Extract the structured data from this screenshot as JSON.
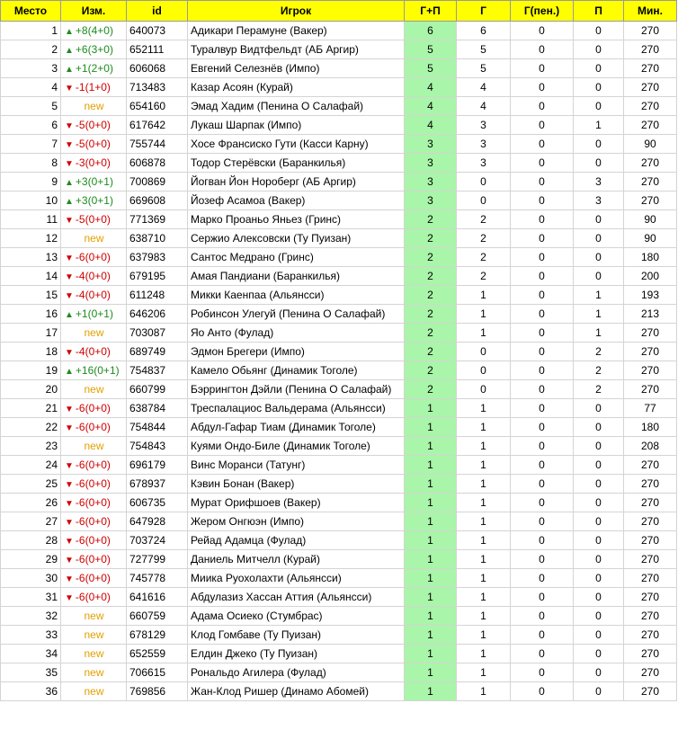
{
  "headers": [
    "Место",
    "Изм.",
    "id",
    "Игрок",
    "Г+П",
    "Г",
    "Г(пен.)",
    "П",
    "Мин."
  ],
  "rows": [
    {
      "place": "1",
      "dir": "up",
      "change": "+8(4+0)",
      "id": "640073",
      "player": "Адикари Перамуне (Вакер)",
      "gp": "6",
      "g": "6",
      "gpen": "0",
      "p": "0",
      "min": "270"
    },
    {
      "place": "2",
      "dir": "up",
      "change": "+6(3+0)",
      "id": "652111",
      "player": "Туралвур Видтфельдт (АБ Аргир)",
      "gp": "5",
      "g": "5",
      "gpen": "0",
      "p": "0",
      "min": "270"
    },
    {
      "place": "3",
      "dir": "up",
      "change": "+1(2+0)",
      "id": "606068",
      "player": "Евгений Селезнёв (Импо)",
      "gp": "5",
      "g": "5",
      "gpen": "0",
      "p": "0",
      "min": "270"
    },
    {
      "place": "4",
      "dir": "down",
      "change": "-1(1+0)",
      "id": "713483",
      "player": "Казар Асоян (Курай)",
      "gp": "4",
      "g": "4",
      "gpen": "0",
      "p": "0",
      "min": "270"
    },
    {
      "place": "5",
      "dir": "new",
      "change": "new",
      "id": "654160",
      "player": "Эмад Хадим (Пенина О Салафай)",
      "gp": "4",
      "g": "4",
      "gpen": "0",
      "p": "0",
      "min": "270"
    },
    {
      "place": "6",
      "dir": "down",
      "change": "-5(0+0)",
      "id": "617642",
      "player": "Лукаш Шарпак (Импо)",
      "gp": "4",
      "g": "3",
      "gpen": "0",
      "p": "1",
      "min": "270"
    },
    {
      "place": "7",
      "dir": "down",
      "change": "-5(0+0)",
      "id": "755744",
      "player": "Хосе Франсиско Гути (Касси Карну)",
      "gp": "3",
      "g": "3",
      "gpen": "0",
      "p": "0",
      "min": "90"
    },
    {
      "place": "8",
      "dir": "down",
      "change": "-3(0+0)",
      "id": "606878",
      "player": "Тодор Стерёвски (Баранкилья)",
      "gp": "3",
      "g": "3",
      "gpen": "0",
      "p": "0",
      "min": "270"
    },
    {
      "place": "9",
      "dir": "up",
      "change": "+3(0+1)",
      "id": "700869",
      "player": "Йогван Йон Нороберг (АБ Аргир)",
      "gp": "3",
      "g": "0",
      "gpen": "0",
      "p": "3",
      "min": "270"
    },
    {
      "place": "10",
      "dir": "up",
      "change": "+3(0+1)",
      "id": "669608",
      "player": "Йозеф Асамоа (Вакер)",
      "gp": "3",
      "g": "0",
      "gpen": "0",
      "p": "3",
      "min": "270"
    },
    {
      "place": "11",
      "dir": "down",
      "change": "-5(0+0)",
      "id": "771369",
      "player": "Марко Проаньо Яньез (Гринс)",
      "gp": "2",
      "g": "2",
      "gpen": "0",
      "p": "0",
      "min": "90"
    },
    {
      "place": "12",
      "dir": "new",
      "change": "new",
      "id": "638710",
      "player": "Сержио Алексовски (Ту Пуизан)",
      "gp": "2",
      "g": "2",
      "gpen": "0",
      "p": "0",
      "min": "90"
    },
    {
      "place": "13",
      "dir": "down",
      "change": "-6(0+0)",
      "id": "637983",
      "player": "Сантос Медрано (Гринс)",
      "gp": "2",
      "g": "2",
      "gpen": "0",
      "p": "0",
      "min": "180"
    },
    {
      "place": "14",
      "dir": "down",
      "change": "-4(0+0)",
      "id": "679195",
      "player": "Амая Пандиани (Баранкилья)",
      "gp": "2",
      "g": "2",
      "gpen": "0",
      "p": "0",
      "min": "200"
    },
    {
      "place": "15",
      "dir": "down",
      "change": "-4(0+0)",
      "id": "611248",
      "player": "Микки Каенпаа (Альянсси)",
      "gp": "2",
      "g": "1",
      "gpen": "0",
      "p": "1",
      "min": "193"
    },
    {
      "place": "16",
      "dir": "up",
      "change": "+1(0+1)",
      "id": "646206",
      "player": "Робинсон Улегуй (Пенина О Салафай)",
      "gp": "2",
      "g": "1",
      "gpen": "0",
      "p": "1",
      "min": "213"
    },
    {
      "place": "17",
      "dir": "new",
      "change": "new",
      "id": "703087",
      "player": "Яо Анто (Фулад)",
      "gp": "2",
      "g": "1",
      "gpen": "0",
      "p": "1",
      "min": "270"
    },
    {
      "place": "18",
      "dir": "down",
      "change": "-4(0+0)",
      "id": "689749",
      "player": "Эдмон Брегери (Импо)",
      "gp": "2",
      "g": "0",
      "gpen": "0",
      "p": "2",
      "min": "270"
    },
    {
      "place": "19",
      "dir": "up",
      "change": "+16(0+1)",
      "id": "754837",
      "player": "Камело Обьянг (Динамик Тоголе)",
      "gp": "2",
      "g": "0",
      "gpen": "0",
      "p": "2",
      "min": "270"
    },
    {
      "place": "20",
      "dir": "new",
      "change": "new",
      "id": "660799",
      "player": "Бэррингтон Дэйли (Пенина О Салафай)",
      "gp": "2",
      "g": "0",
      "gpen": "0",
      "p": "2",
      "min": "270"
    },
    {
      "place": "21",
      "dir": "down",
      "change": "-6(0+0)",
      "id": "638784",
      "player": "Треспалациос Вальдерама (Альянсси)",
      "gp": "1",
      "g": "1",
      "gpen": "0",
      "p": "0",
      "min": "77"
    },
    {
      "place": "22",
      "dir": "down",
      "change": "-6(0+0)",
      "id": "754844",
      "player": "Абдул-Гафар Тиам (Динамик Тоголе)",
      "gp": "1",
      "g": "1",
      "gpen": "0",
      "p": "0",
      "min": "180"
    },
    {
      "place": "23",
      "dir": "new",
      "change": "new",
      "id": "754843",
      "player": "Куями Ондо-Биле (Динамик Тоголе)",
      "gp": "1",
      "g": "1",
      "gpen": "0",
      "p": "0",
      "min": "208"
    },
    {
      "place": "24",
      "dir": "down",
      "change": "-6(0+0)",
      "id": "696179",
      "player": "Винс Моранси (Татунг)",
      "gp": "1",
      "g": "1",
      "gpen": "0",
      "p": "0",
      "min": "270"
    },
    {
      "place": "25",
      "dir": "down",
      "change": "-6(0+0)",
      "id": "678937",
      "player": "Кэвин Бонан (Вакер)",
      "gp": "1",
      "g": "1",
      "gpen": "0",
      "p": "0",
      "min": "270"
    },
    {
      "place": "26",
      "dir": "down",
      "change": "-6(0+0)",
      "id": "606735",
      "player": "Мурат Орифшоев (Вакер)",
      "gp": "1",
      "g": "1",
      "gpen": "0",
      "p": "0",
      "min": "270"
    },
    {
      "place": "27",
      "dir": "down",
      "change": "-6(0+0)",
      "id": "647928",
      "player": "Жером Онгюэн (Импо)",
      "gp": "1",
      "g": "1",
      "gpen": "0",
      "p": "0",
      "min": "270"
    },
    {
      "place": "28",
      "dir": "down",
      "change": "-6(0+0)",
      "id": "703724",
      "player": "Рейад Адамца (Фулад)",
      "gp": "1",
      "g": "1",
      "gpen": "0",
      "p": "0",
      "min": "270"
    },
    {
      "place": "29",
      "dir": "down",
      "change": "-6(0+0)",
      "id": "727799",
      "player": "Даниель Митчелл (Курай)",
      "gp": "1",
      "g": "1",
      "gpen": "0",
      "p": "0",
      "min": "270"
    },
    {
      "place": "30",
      "dir": "down",
      "change": "-6(0+0)",
      "id": "745778",
      "player": "Миика Руохолахти (Альянсси)",
      "gp": "1",
      "g": "1",
      "gpen": "0",
      "p": "0",
      "min": "270"
    },
    {
      "place": "31",
      "dir": "down",
      "change": "-6(0+0)",
      "id": "641616",
      "player": "Абдулазиз Хассан Аттия (Альянсси)",
      "gp": "1",
      "g": "1",
      "gpen": "0",
      "p": "0",
      "min": "270"
    },
    {
      "place": "32",
      "dir": "new",
      "change": "new",
      "id": "660759",
      "player": "Адама Осиеко (Стумбрас)",
      "gp": "1",
      "g": "1",
      "gpen": "0",
      "p": "0",
      "min": "270"
    },
    {
      "place": "33",
      "dir": "new",
      "change": "new",
      "id": "678129",
      "player": "Клод Гомбаве (Ту Пуизан)",
      "gp": "1",
      "g": "1",
      "gpen": "0",
      "p": "0",
      "min": "270"
    },
    {
      "place": "34",
      "dir": "new",
      "change": "new",
      "id": "652559",
      "player": "Елдин Джеко (Ту Пуизан)",
      "gp": "1",
      "g": "1",
      "gpen": "0",
      "p": "0",
      "min": "270"
    },
    {
      "place": "35",
      "dir": "new",
      "change": "new",
      "id": "706615",
      "player": "Рональдо Агилера (Фулад)",
      "gp": "1",
      "g": "1",
      "gpen": "0",
      "p": "0",
      "min": "270"
    },
    {
      "place": "36",
      "dir": "new",
      "change": "new",
      "id": "769856",
      "player": "Жан-Клод Ришер (Динамо Абомей)",
      "gp": "1",
      "g": "1",
      "gpen": "0",
      "p": "0",
      "min": "270"
    }
  ],
  "colors": {
    "header": "#ffff00",
    "gp_fill": "#a9f5a9",
    "up": "#1e8a1e",
    "down": "#d00000",
    "new": "#e4a000"
  }
}
